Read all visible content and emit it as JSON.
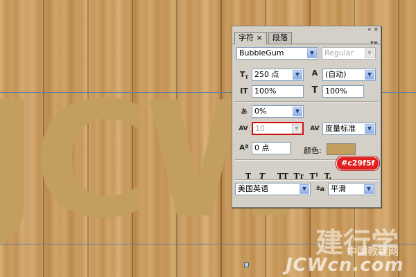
{
  "canvas": {
    "display_text": "JCW",
    "text_color": "#c29f5f",
    "watermark_brand": "建行学",
    "watermark_site_cn": "中国教程网",
    "watermark_url": "JCWcn.com"
  },
  "panel": {
    "tabs": [
      {
        "label": "字符 ×"
      },
      {
        "label": "段落"
      }
    ],
    "window_controls": "« ×",
    "menu_icon": "▾≡",
    "font_family": "BubbleGum",
    "font_style": "Regular",
    "font_size": "250 点",
    "leading": "(自动)",
    "vertical_scale": "100%",
    "horizontal_scale": "100%",
    "tsume": "0%",
    "kerning": "10",
    "tracking": "度量标准",
    "baseline_shift": "0 点",
    "color_label": "颜色:",
    "color_value": "#c29f5f",
    "color_tooltip": "#c29f5f",
    "style_buttons": [
      "T",
      "T",
      "TT",
      "Tт",
      "T¹",
      "T,"
    ],
    "language": "美国英语",
    "aa_icon": "ªa",
    "anti_alias": "平滑"
  }
}
